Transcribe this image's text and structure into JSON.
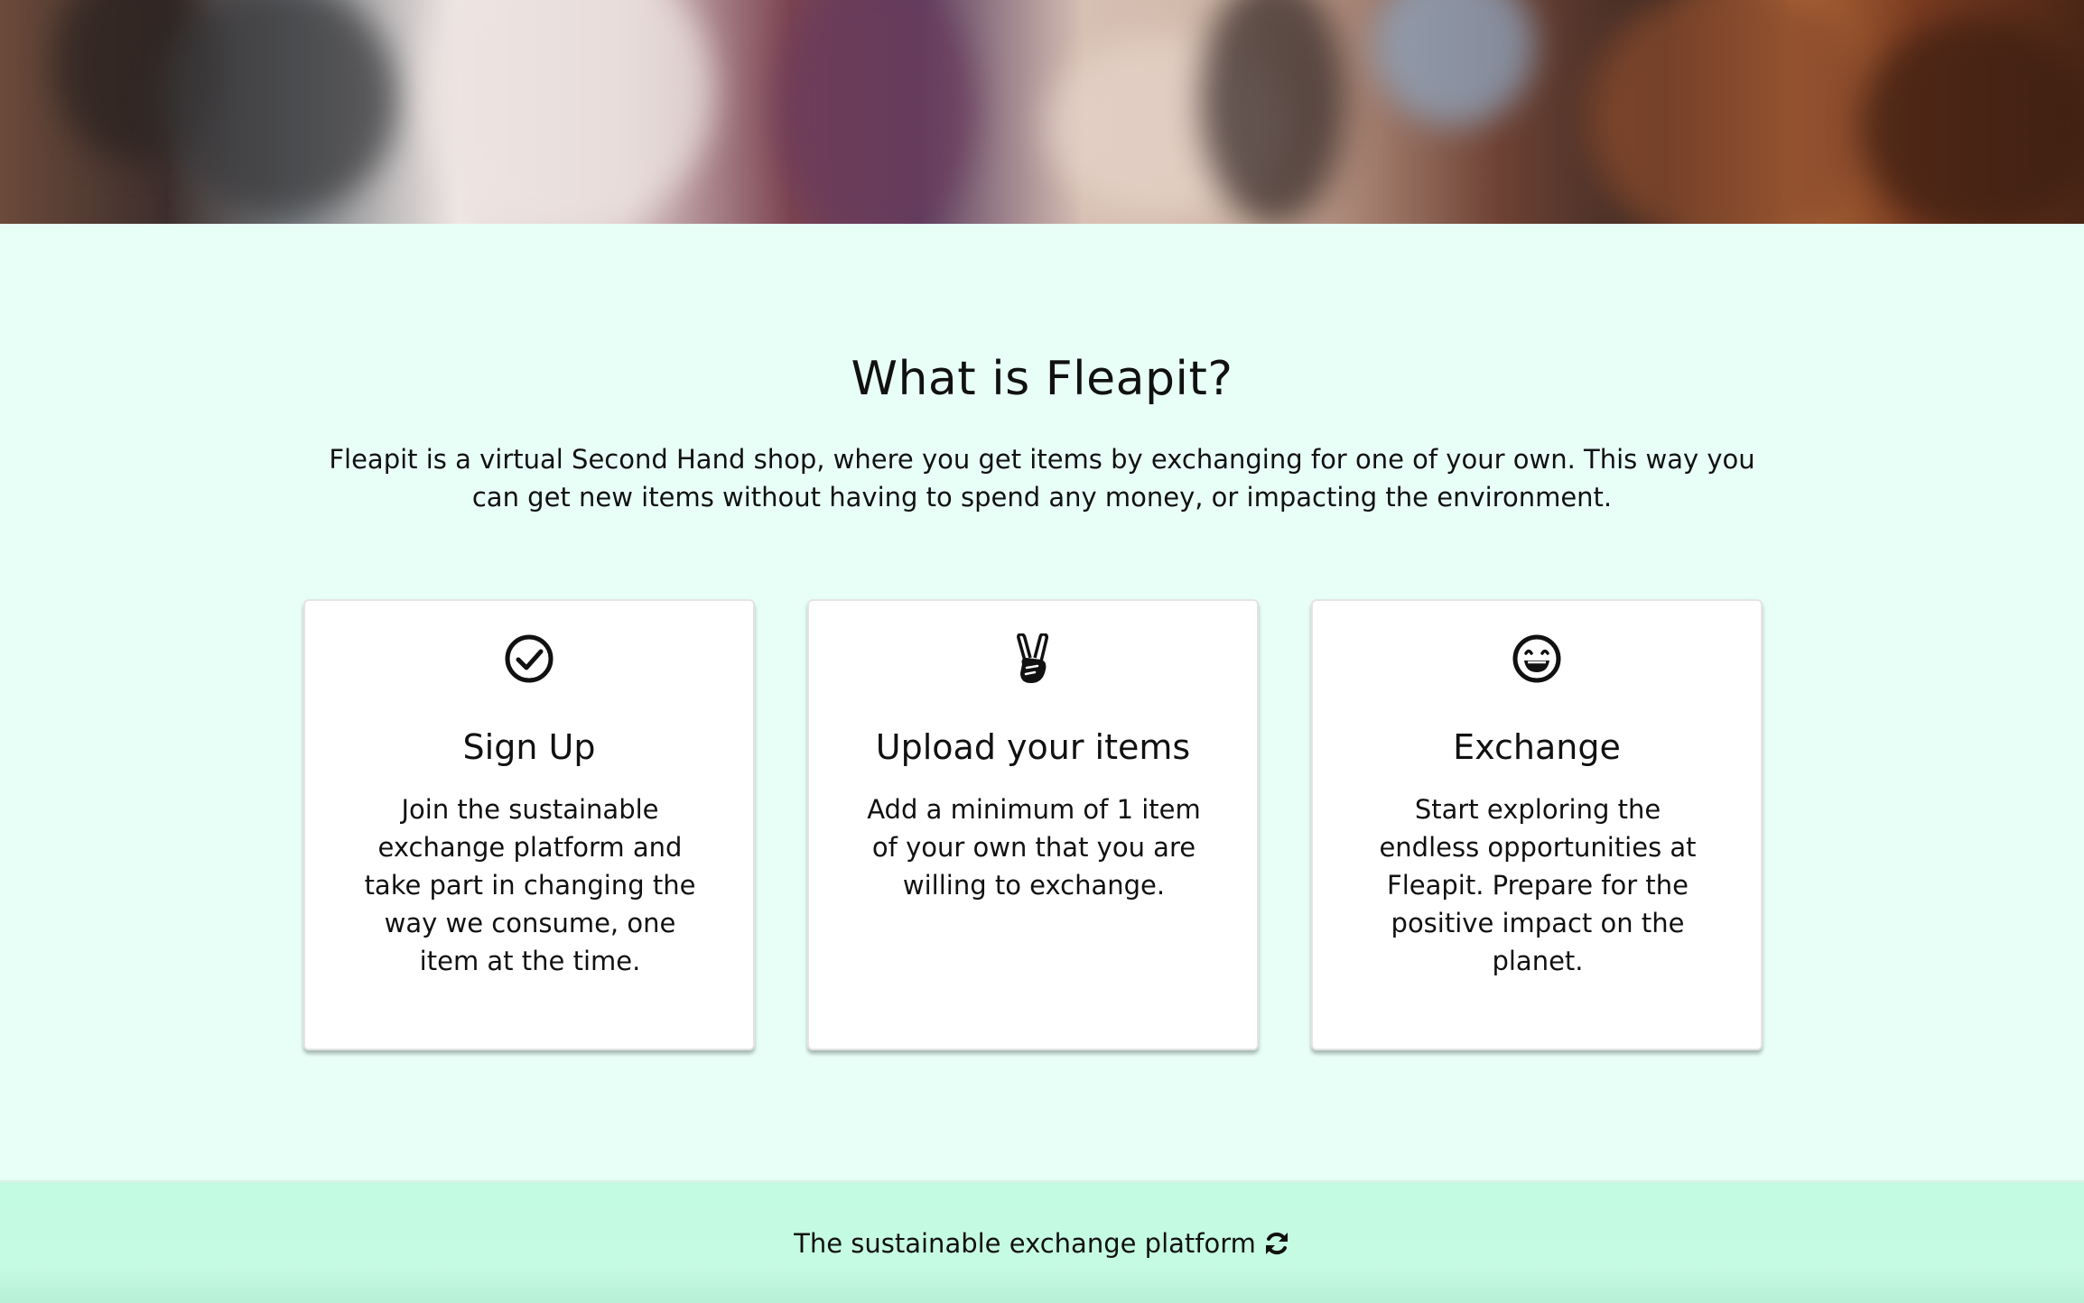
{
  "hero": {
    "image_description_icon": "photo-banner-people"
  },
  "about": {
    "title": "What is Fleapit?",
    "intro": "Fleapit is a virtual Second Hand shop, where you get items by exchanging for one of your own. This way you can get new items without having to spend any money, or impacting the environment."
  },
  "cards": [
    {
      "icon": "check-circle-icon",
      "title": "Sign Up",
      "text": "Join the sustainable exchange platform and take part in changing the way we consume, one item at the time."
    },
    {
      "icon": "peace-hand-icon",
      "title": "Upload your items",
      "text": "Add a minimum of 1 item of your own that you are willing to exchange."
    },
    {
      "icon": "laughing-face-icon",
      "title": "Exchange",
      "text": "Start exploring the endless opportunities at Fleapit. Prepare for the positive impact on the planet."
    }
  ],
  "footer": {
    "tagline": "The sustainable exchange platform",
    "icon": "refresh-icon"
  },
  "colors": {
    "page_background": "#e8fff8",
    "footer_background": "#c4fbe3",
    "card_background": "#ffffff",
    "text": "#111111"
  }
}
